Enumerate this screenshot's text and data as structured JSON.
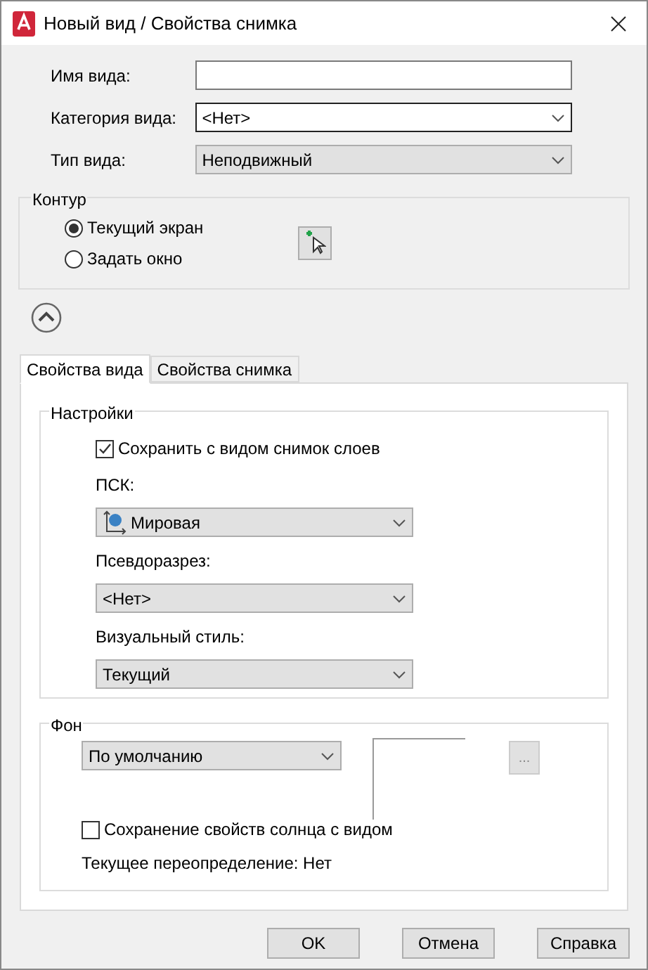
{
  "window": {
    "title": "Новый вид / Свойства снимка"
  },
  "fields": [
    {
      "label": "Имя вида:",
      "kind": "text"
    },
    {
      "label": "Категория вида:",
      "kind": "combo",
      "value": "<Нет>"
    },
    {
      "label": "Тип вида:",
      "kind": "dropdown",
      "value": "Неподвижный"
    }
  ],
  "contour": {
    "title": "Контур",
    "options": [
      {
        "label": "Текущий экран",
        "selected": true
      },
      {
        "label": "Задать окно",
        "selected": false
      }
    ]
  },
  "tabs": [
    {
      "label": "Свойства вида",
      "selected": true
    },
    {
      "label": "Свойства снимка",
      "selected": false
    }
  ],
  "settings": {
    "title": "Настройки",
    "save_layers": {
      "label": "Сохранить с видом снимок слоев",
      "checked": true
    },
    "dropdowns": [
      {
        "label": "ПСК:",
        "value": "Мировая",
        "kind": "ucs"
      },
      {
        "label": "Псевдоразрез:",
        "value": "<Нет>",
        "kind": "plain"
      },
      {
        "label": "Визуальный стиль:",
        "value": "Текущий",
        "kind": "plain"
      }
    ]
  },
  "background": {
    "title": "Фон",
    "value": "По умолчанию",
    "browse": "...",
    "sun": {
      "label": "Сохранение свойств солнца с видом",
      "checked": false
    },
    "override": "Текущее переопределение: Нет"
  },
  "buttons": [
    "OK",
    "Отмена",
    "Справка"
  ]
}
